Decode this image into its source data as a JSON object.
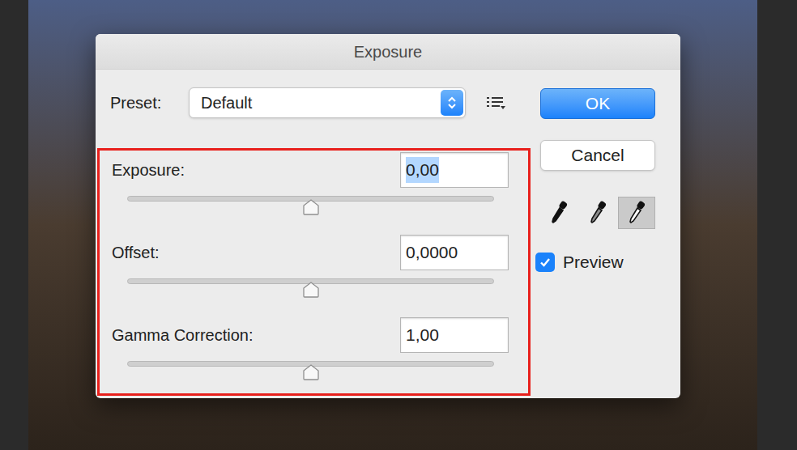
{
  "window": {
    "title": "Exposure"
  },
  "preset": {
    "label": "Preset:",
    "value": "Default"
  },
  "fields_highlighted": true,
  "fields": [
    {
      "label": "Exposure:",
      "value": "0,00",
      "level": 0.5,
      "selected": true
    },
    {
      "label": "Offset:",
      "value": "0,0000",
      "level": 0.5,
      "selected": false
    },
    {
      "label": "Gamma Correction:",
      "value": "1,00",
      "level": 0.5,
      "selected": false
    }
  ],
  "buttons": [
    {
      "label": "OK",
      "default": true
    },
    {
      "label": "Cancel",
      "default": false
    }
  ],
  "eyedroppers": [
    {
      "kind": "black",
      "selected": false
    },
    {
      "kind": "gray",
      "selected": false
    },
    {
      "kind": "white",
      "selected": true
    }
  ],
  "preview": {
    "label": "Preview",
    "checked": true
  }
}
